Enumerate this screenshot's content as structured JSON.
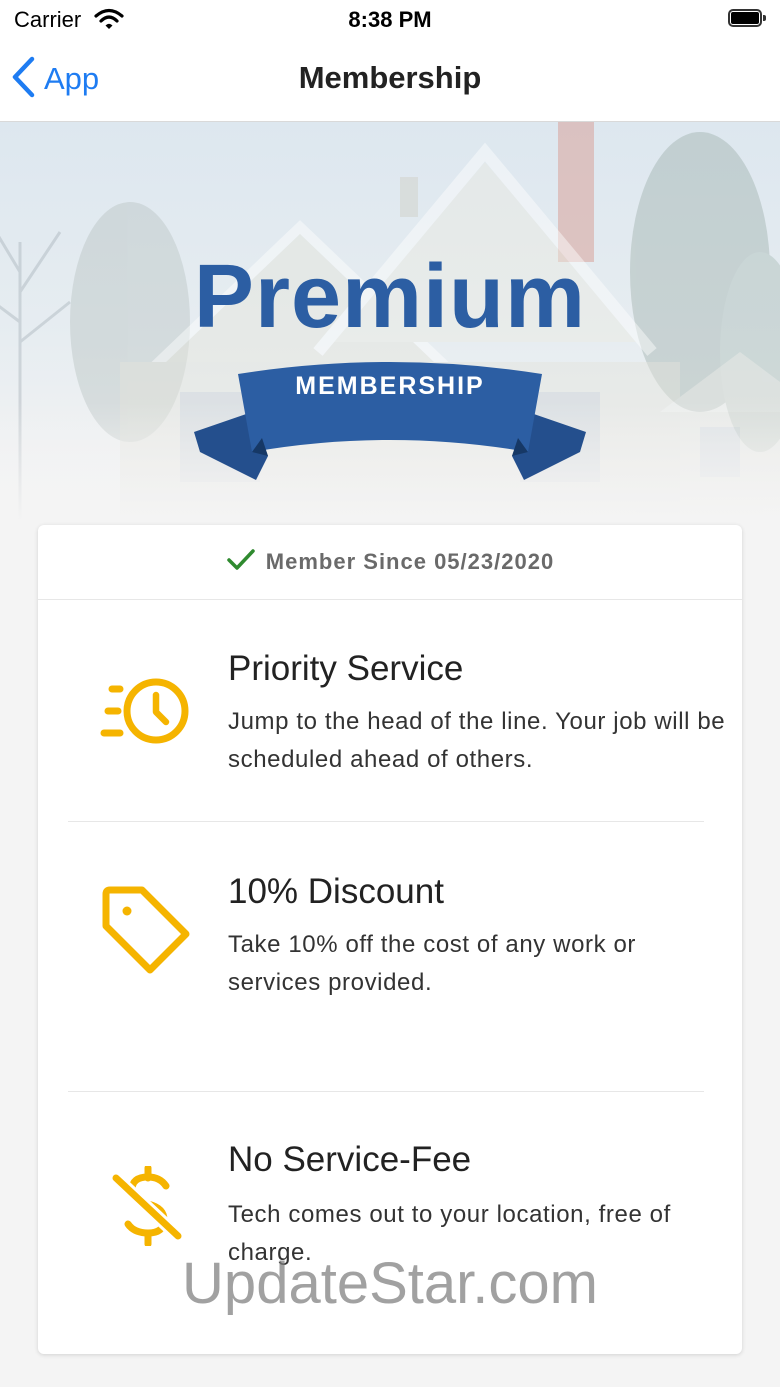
{
  "status_bar": {
    "carrier": "Carrier",
    "time": "8:38 PM"
  },
  "nav": {
    "back_label": "App",
    "title": "Membership"
  },
  "hero": {
    "title": "Premium",
    "ribbon_text": "MEMBERSHIP"
  },
  "card": {
    "member_since": "Member Since 05/23/2020",
    "benefits": [
      {
        "title": "Priority Service",
        "description": "Jump to the head of the line. Your job will be scheduled ahead of others.",
        "icon": "fast-clock-icon"
      },
      {
        "title": "10% Discount",
        "description": "Take 10% off the cost of any work or services provided.",
        "icon": "price-tag-icon"
      },
      {
        "title": "No Service-Fee",
        "description": "Tech comes out to your location, free of charge.",
        "icon": "no-dollar-icon"
      }
    ]
  },
  "watermark": "UpdateStar.com",
  "colors": {
    "accent_blue": "#1e7cf2",
    "brand_blue": "#2c5ea3",
    "icon_yellow": "#f5b400",
    "check_green": "#2f8a2f"
  }
}
